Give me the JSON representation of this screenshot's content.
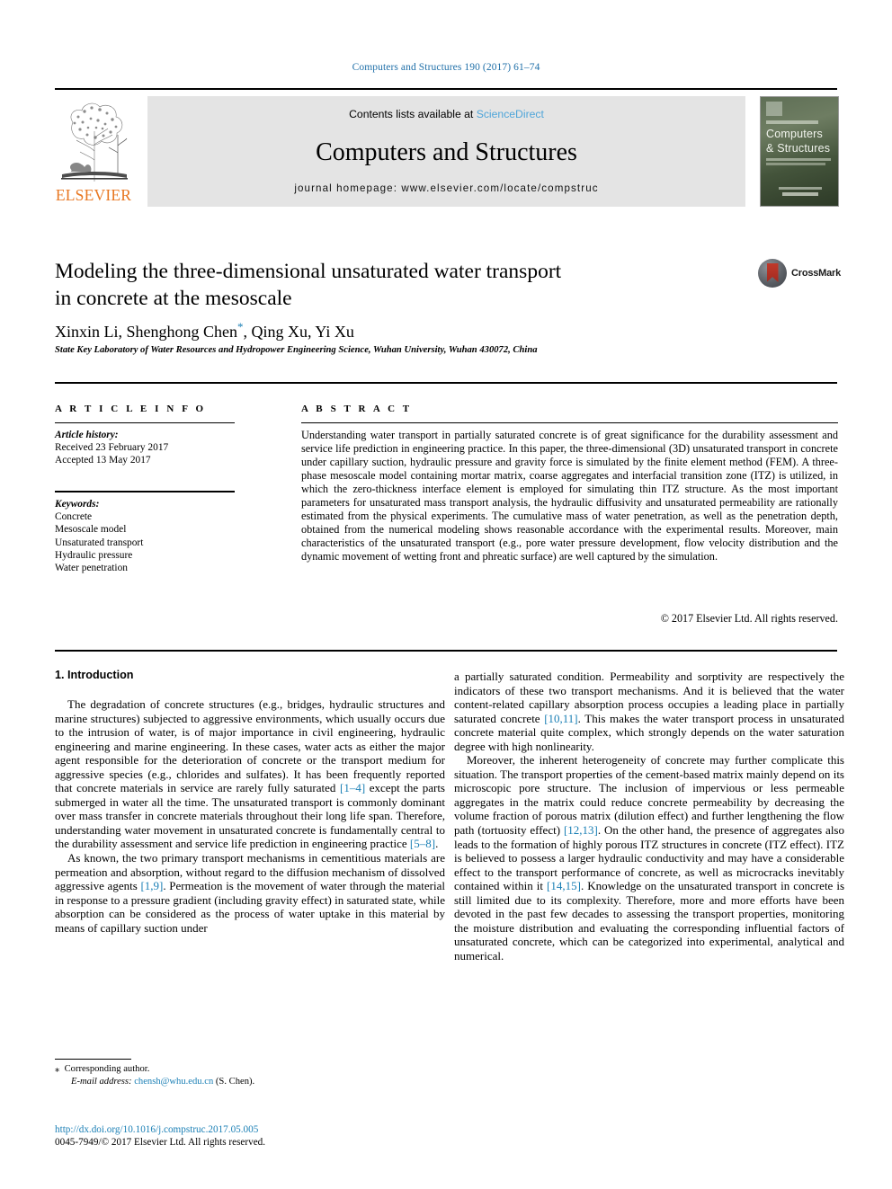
{
  "running_head": "Computers and Structures 190 (2017) 61–74",
  "masthead": {
    "publisher_name": "ELSEVIER",
    "contents_prefix": "Contents lists available at ",
    "contents_link": "ScienceDirect",
    "journal_title": "Computers and Structures",
    "homepage": "journal homepage: www.elsevier.com/locate/compstruc",
    "cover": {
      "line1": "Computers",
      "line2": "& Structures"
    }
  },
  "article": {
    "title_line1": "Modeling the three-dimensional unsaturated water transport",
    "title_line2": "in concrete at the mesoscale",
    "authors": "Xinxin Li, Shenghong Chen",
    "authors_rest": ", Qing Xu, Yi Xu",
    "corresponding_marker": "*",
    "affiliation": "State Key Laboratory of Water Resources and Hydropower Engineering Science, Wuhan University, Wuhan 430072, China",
    "crossmark_label": "CrossMark"
  },
  "article_info": {
    "heading": "A R T I C L E   I N F O",
    "history_label": "Article history:",
    "received": "Received 23 February 2017",
    "accepted": "Accepted 13 May 2017",
    "keywords_label": "Keywords:",
    "keywords": [
      "Concrete",
      "Mesoscale model",
      "Unsaturated transport",
      "Hydraulic pressure",
      "Water penetration"
    ]
  },
  "abstract": {
    "heading": "A B S T R A C T",
    "text": "Understanding water transport in partially saturated concrete is of great significance for the durability assessment and service life prediction in engineering practice. In this paper, the three-dimensional (3D) unsaturated transport in concrete under capillary suction, hydraulic pressure and gravity force is simulated by the finite element method (FEM). A three-phase mesoscale model containing mortar matrix, coarse aggregates and interfacial transition zone (ITZ) is utilized, in which the zero-thickness interface element is employed for simulating thin ITZ structure. As the most important parameters for unsaturated mass transport analysis, the hydraulic diffusivity and unsaturated permeability are rationally estimated from the physical experiments. The cumulative mass of water penetration, as well as the penetration depth, obtained from the numerical modeling shows reasonable accordance with the experimental results. Moreover, main characteristics of the unsaturated transport (e.g., pore water pressure development, flow velocity distribution and the dynamic movement of wetting front and phreatic surface) are well captured by the simulation.",
    "copyright": "© 2017 Elsevier Ltd. All rights reserved."
  },
  "body": {
    "section_heading": "1. Introduction",
    "left_p1_a": "The degradation of concrete structures (e.g., bridges, hydraulic structures and marine structures) subjected to aggressive environments, which usually occurs due to the intrusion of water, is of major importance in civil engineering, hydraulic engineering and marine engineering. In these cases, water acts as either the major agent responsible for the deterioration of concrete or the transport medium for aggressive species (e.g., chlorides and sulfates). It has been frequently reported that concrete materials in service are rarely fully saturated ",
    "left_p1_ref1": "[1–4]",
    "left_p1_b": " except the parts submerged in water all the time. The unsaturated transport is commonly dominant over mass transfer in concrete materials throughout their long life span. Therefore, understanding water movement in unsaturated concrete is fundamentally central to the durability assessment and service life prediction in engineering practice ",
    "left_p1_ref2": "[5–8]",
    "left_p1_c": ".",
    "left_p2_a": "As known, the two primary transport mechanisms in cementitious materials are permeation and absorption, without regard to the diffusion mechanism of dissolved aggressive agents ",
    "left_p2_ref1": "[1,9]",
    "left_p2_b": ". Permeation is the movement of water through the material in response to a pressure gradient (including gravity effect) in saturated state, while absorption can be considered as the process of water uptake in this material by means of capillary suction under",
    "right_p1_a": "a partially saturated condition. Permeability and sorptivity are respectively the indicators of these two transport mechanisms. And it is believed that the water content-related capillary absorption process occupies a leading place in partially saturated concrete ",
    "right_p1_ref1": "[10,11]",
    "right_p1_b": ". This makes the water transport process in unsaturated concrete material quite complex, which strongly depends on the water saturation degree with high nonlinearity.",
    "right_p2_a": "Moreover, the inherent heterogeneity of concrete may further complicate this situation. The transport properties of the cement-based matrix mainly depend on its microscopic pore structure. The inclusion of impervious or less permeable aggregates in the matrix could reduce concrete permeability by decreasing the volume fraction of porous matrix (dilution effect) and further lengthening the flow path (tortuosity effect) ",
    "right_p2_ref1": "[12,13]",
    "right_p2_b": ". On the other hand, the presence of aggregates also leads to the formation of highly porous ITZ structures in concrete (ITZ effect). ITZ is believed to possess a larger hydraulic conductivity and may have a considerable effect to the transport performance of concrete, as well as microcracks inevitably contained within it ",
    "right_p2_ref2": "[14,15]",
    "right_p2_c": ". Knowledge on the unsaturated transport in concrete is still limited due to its complexity. Therefore, more and more efforts have been devoted in the past few decades to assessing the transport properties, monitoring the moisture distribution and evaluating the corresponding influential factors of unsaturated concrete, which can be categorized into experimental, analytical and numerical."
  },
  "footnote": {
    "marker": "⁎",
    "corresponding": "Corresponding author.",
    "email_label": "E-mail address:",
    "email": "chensh@whu.edu.cn",
    "email_suffix": "(S. Chen)."
  },
  "imprint": {
    "doi": "http://dx.doi.org/10.1016/j.compstruc.2017.05.005",
    "issn_line": "0045-7949/© 2017 Elsevier Ltd. All rights reserved."
  },
  "colors": {
    "link": "#1a7fb5",
    "sciencedirect": "#4ea5d9",
    "elsevier_orange": "#e87722",
    "gray_box": "#e4e4e4"
  }
}
